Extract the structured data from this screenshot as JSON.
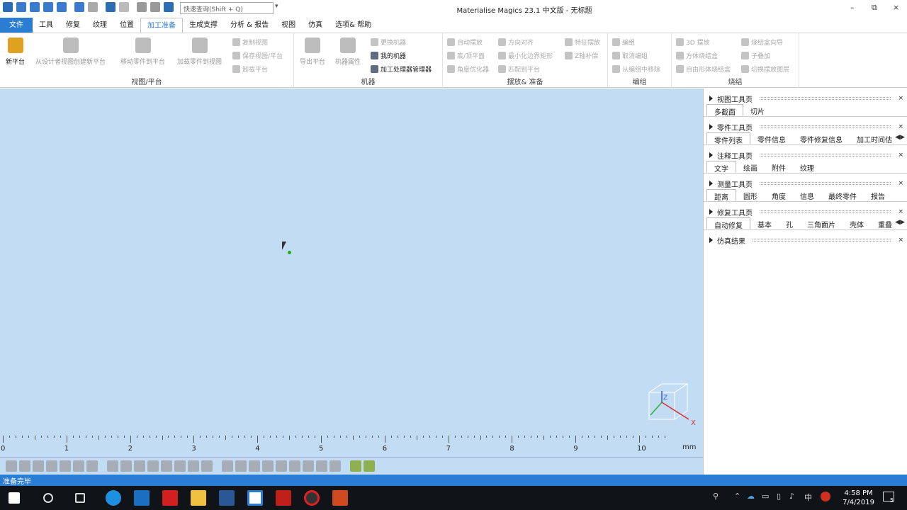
{
  "titlebar": {
    "search_placeholder": "快速查询(Shift + Q)",
    "title": "Materialise Magics 23.1 中文版 - 无标题",
    "minimize": "–",
    "restore": "⧉",
    "close": "×"
  },
  "tabs": [
    "文件",
    "工具",
    "修复",
    "纹理",
    "位置",
    "加工准备",
    "生成支撑",
    "分析 & 报告",
    "视图",
    "仿真",
    "选项& 帮助"
  ],
  "ribbon": {
    "grp1": {
      "label": "视图/平台",
      "new": "新平台",
      "from_design": "从设计者视图创建新平台",
      "move": "移动零件到平台",
      "load": "加载零件到视图",
      "copy": "复制视图",
      "save": "保存视图/平台",
      "unload": "卸载平台"
    },
    "grp2": {
      "label": "机器",
      "export": "导出平台",
      "props": "机器属性",
      "change": "更换机器",
      "mine": "我的机器",
      "mgr": "加工处理器管理器"
    },
    "grp3": {
      "label": "摆放& 准备",
      "auto": "自动摆放",
      "dir": "方向对齐",
      "feature": "特征摆放",
      "bottom": "底/顶平面",
      "minbox": "最小化边界矩形",
      "z": "Z轴补偿",
      "angle": "角度优化器",
      "match": "匹配到平台"
    },
    "grp4": {
      "label": "编组",
      "group": "编组",
      "ungroup": "取消编组",
      "remove": "从编组中移除"
    },
    "grp5": {
      "label": "烧结",
      "s3d": "3D 摆放",
      "box": "方体烧结盒",
      "free": "自由形体烧结盒",
      "wiz": "烧结盒向导",
      "stack": "子叠加",
      "switch": "切换摆放图层"
    }
  },
  "ruler": {
    "labels": [
      "0",
      "1",
      "2",
      "3",
      "4",
      "5",
      "6",
      "7",
      "8",
      "9",
      "10"
    ],
    "unit": "mm"
  },
  "cube": {
    "z": "Z",
    "x": "X"
  },
  "panel": [
    {
      "title": "视图工具页",
      "tabs": [
        "多截面",
        "切片"
      ]
    },
    {
      "title": "零件工具页",
      "tabs": [
        "零件列表",
        "零件信息",
        "零件修复信息",
        "加工时间估"
      ]
    },
    {
      "title": "注释工具页",
      "tabs": [
        "文字",
        "绘画",
        "附件",
        "纹理"
      ]
    },
    {
      "title": "测量工具页",
      "tabs": [
        "距离",
        "圆形",
        "角度",
        "信息",
        "最终零件",
        "报告"
      ]
    },
    {
      "title": "修复工具页",
      "tabs": [
        "自动修复",
        "基本",
        "孔",
        "三角面片",
        "壳体",
        "重叠"
      ]
    },
    {
      "title": "仿真结果",
      "tabs": []
    }
  ],
  "status": "准备完毕",
  "taskbar": {
    "time": "4:58 PM",
    "date": "7/4/2019",
    "ime": "中",
    "notif": "5"
  },
  "colors": {
    "accent": "#2b7cd3",
    "viewport": "#c2dcf4"
  }
}
